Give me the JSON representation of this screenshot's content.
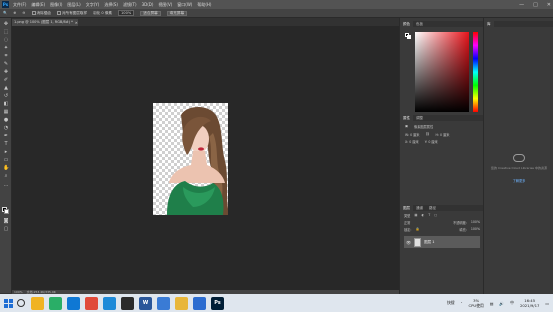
{
  "app": {
    "logo": "Ps",
    "menu": [
      "文件(F)",
      "编辑(E)",
      "图像(I)",
      "图层(L)",
      "文字(Y)",
      "选择(S)",
      "滤镜(T)",
      "3D(D)",
      "视图(V)",
      "窗口(W)",
      "帮助(H)"
    ],
    "window_controls": [
      "—",
      "□",
      "✕"
    ]
  },
  "options": {
    "antialias_label": "消除锯齿",
    "sample_label": "对所有图层取样",
    "feather_label": "羽化",
    "feather_value": "0 像素",
    "zoom_value": "100%",
    "fit_label": "适合屏幕",
    "fill_label": "填充屏幕"
  },
  "document": {
    "tab_title": "1.png @ 100% (图层 1, RGB/8#) *",
    "close_icon": "✕"
  },
  "statusbar": {
    "zoom": "100%",
    "doc_info": "文档:253.4K/335.9K"
  },
  "color_panel": {
    "tabs": [
      "颜色",
      "色板"
    ]
  },
  "properties_panel": {
    "tabs": [
      "属性",
      "调整"
    ],
    "title": "像素图层属性",
    "w_label": "W:",
    "w_value": "0 厘米",
    "h_label": "H:",
    "h_value": "0 厘米",
    "x_label": "X:",
    "x_value": "0 厘米",
    "y_label": "Y:",
    "y_value": "0 厘米"
  },
  "layers_panel": {
    "tabs": [
      "图层",
      "通道",
      "路径"
    ],
    "kind_label": "类型",
    "blend_mode": "正常",
    "opacity_label": "不透明度:",
    "opacity_value": "100%",
    "lock_label": "锁定:",
    "fill_label": "填充:",
    "fill_value": "100%",
    "layers": [
      {
        "name": "图层 1",
        "visible": true
      }
    ]
  },
  "libraries_panel": {
    "tabs": [
      "库"
    ],
    "message": "您的 Creative Cloud Libraries 中的资源",
    "link": "了解更多"
  },
  "taskbar": {
    "apps": [
      {
        "icon": "file-explorer-icon",
        "label": "",
        "color": "#f0b323"
      },
      {
        "icon": "wechat-icon",
        "label": "",
        "color": "#2aae67"
      },
      {
        "icon": "edge-icon",
        "label": "",
        "color": "#0f78d4"
      },
      {
        "icon": "chrome-icon",
        "label": "",
        "color": "#e04a3a"
      },
      {
        "icon": "qq-browser-icon",
        "label": "",
        "color": "#1e8ad8"
      },
      {
        "icon": "app-icon",
        "label": "",
        "color": "#2b2b2b"
      },
      {
        "icon": "word-icon",
        "label": "W",
        "color": "#2b579a"
      },
      {
        "icon": "app-blue-icon",
        "label": "",
        "color": "#3a7bd5"
      },
      {
        "icon": "folder-icon",
        "label": "",
        "color": "#e8b63a"
      },
      {
        "icon": "media-icon",
        "label": "",
        "color": "#2c6cd0"
      },
      {
        "icon": "photoshop-icon",
        "label": "Ps",
        "color": "#001e36"
      }
    ],
    "ime": "快搜",
    "cpu_value": "3%",
    "cpu_label": "CPU使用",
    "input_lang": "中",
    "time": "16:45",
    "date": "2021/9/17"
  },
  "colors": {
    "accent": "#31a8ff",
    "picker_hue": "#e8141b"
  }
}
